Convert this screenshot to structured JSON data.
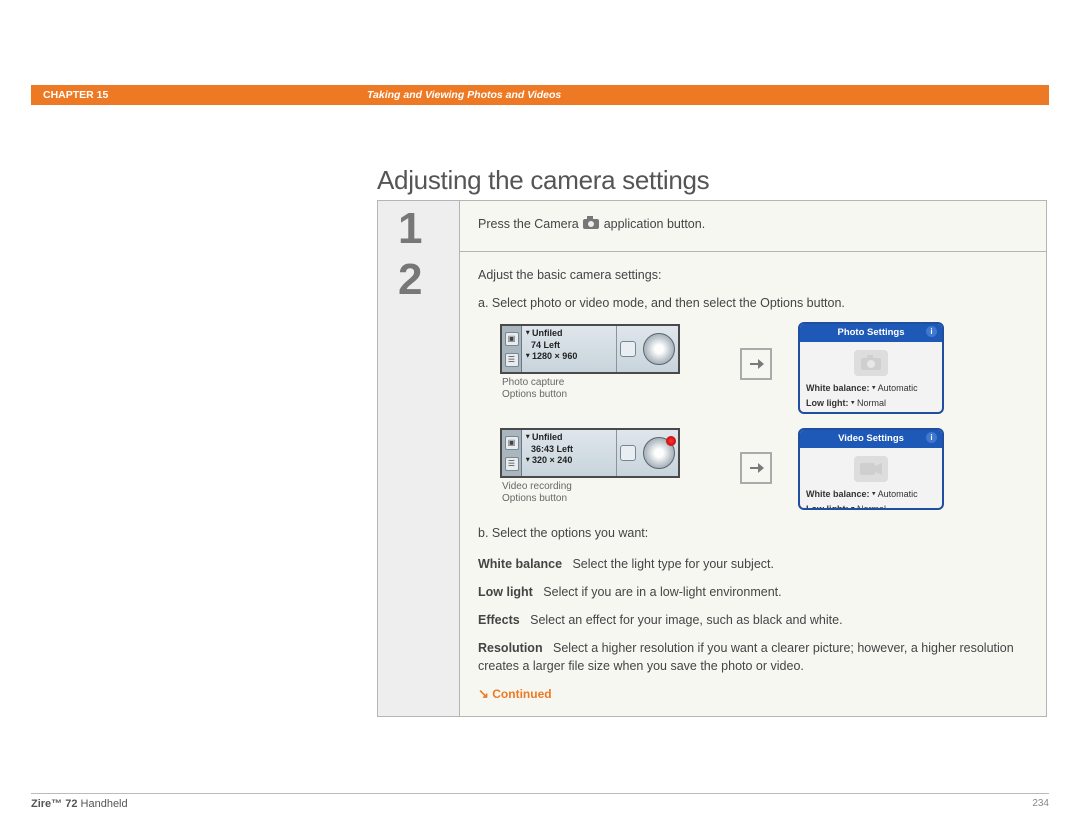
{
  "chapter": {
    "label": "CHAPTER 15",
    "title": "Taking and Viewing Photos and Videos"
  },
  "section_title": "Adjusting the camera settings",
  "steps": {
    "s1": {
      "num": "1",
      "text_before": "Press the Camera ",
      "text_after": " application button."
    },
    "s2": {
      "num": "2",
      "intro": "Adjust the basic camera settings:",
      "a": "a.  Select photo or video mode, and then select the Options button.",
      "b": "b.  Select the options you want:",
      "photo_mini": {
        "folder": "Unfiled",
        "left": "74 Left",
        "res": "1280 × 960"
      },
      "photo_caption_l1": "Photo capture",
      "photo_caption_l2": "Options button",
      "video_mini": {
        "folder": "Unfiled",
        "left": "36:43 Left",
        "res": "320 × 240"
      },
      "video_caption_l1": "Video recording",
      "video_caption_l2": "Options button",
      "photo_settings": {
        "title": "Photo Settings",
        "wb_label": "White balance:",
        "wb_value": "Automatic",
        "ll_label": "Low light:",
        "ll_value": "Normal"
      },
      "video_settings": {
        "title": "Video Settings",
        "wb_label": "White balance:",
        "wb_value": "Automatic",
        "ll_label": "Low light:",
        "ll_value": "Normal"
      },
      "opts": {
        "wb_label": "White balance",
        "wb_desc": "Select the light type for your subject.",
        "ll_label": "Low light",
        "ll_desc": "Select if you are in a low-light environment.",
        "fx_label": "Effects",
        "fx_desc": "Select an effect for your image, such as black and white.",
        "res_label": "Resolution",
        "res_desc": "Select a higher resolution if you want a clearer picture; however, a higher resolution creates a larger file size when you save the photo or video."
      },
      "continued": "Continued"
    }
  },
  "footer": {
    "brand_bold": "Zire™ 72",
    "brand_rest": " Handheld",
    "page": "234"
  }
}
